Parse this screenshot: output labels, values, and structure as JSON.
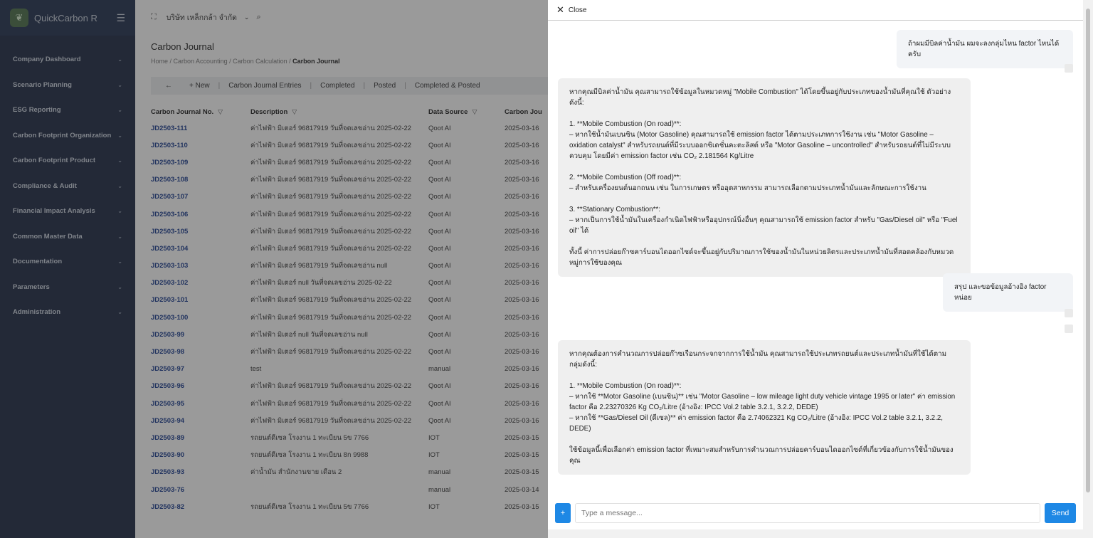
{
  "sidebar": {
    "app_name": "QuickCarbon R",
    "items": [
      {
        "label": "Company Dashboard"
      },
      {
        "label": "Scenario Planning"
      },
      {
        "label": "ESG Reporting"
      },
      {
        "label": "Carbon Footprint Organization"
      },
      {
        "label": "Carbon Footprint Product"
      },
      {
        "label": "Compliance & Audit"
      },
      {
        "label": "Financial Impact Analysis"
      },
      {
        "label": "Common Master Data"
      },
      {
        "label": "Documentation"
      },
      {
        "label": "Parameters"
      },
      {
        "label": "Administration"
      }
    ]
  },
  "topbar": {
    "company": "บริษัท เหล็กกล้า จำกัด"
  },
  "page": {
    "title": "Carbon Journal",
    "breadcrumb": [
      "Home",
      "Carbon Accounting",
      "Carbon Calculation",
      "Carbon Journal"
    ]
  },
  "toolbar": {
    "new_label": "New",
    "tabs": [
      "Carbon Journal Entries",
      "Completed",
      "Posted",
      "Completed & Posted"
    ]
  },
  "grid": {
    "columns": [
      "Carbon Journal No.",
      "Description",
      "Data Source",
      "Carbon Jou"
    ],
    "rows": [
      [
        "JD2503-111",
        "ค่าไฟฟ้า มิเตอร์ 96817919 วันที่จดเลขอ่าน 2025-02-22",
        "Qoot AI",
        "2025-03-16"
      ],
      [
        "JD2503-110",
        "ค่าไฟฟ้า มิเตอร์ 96817919 วันที่จดเลขอ่าน 2025-02-22",
        "Qoot AI",
        "2025-03-16"
      ],
      [
        "JD2503-109",
        "ค่าไฟฟ้า มิเตอร์ 96817919 วันที่จดเลขอ่าน 2025-02-22",
        "Qoot AI",
        "2025-03-16"
      ],
      [
        "JD2503-108",
        "ค่าไฟฟ้า มิเตอร์ 96817919 วันที่จดเลขอ่าน 2025-02-22",
        "Qoot AI",
        "2025-03-16"
      ],
      [
        "JD2503-107",
        "ค่าไฟฟ้า มิเตอร์ 96817919 วันที่จดเลขอ่าน 2025-02-22",
        "Qoot AI",
        "2025-03-16"
      ],
      [
        "JD2503-106",
        "ค่าไฟฟ้า มิเตอร์ 96817919 วันที่จดเลขอ่าน 2025-02-22",
        "Qoot AI",
        "2025-03-16"
      ],
      [
        "JD2503-105",
        "ค่าไฟฟ้า มิเตอร์ 96817919 วันที่จดเลขอ่าน 2025-02-22",
        "Qoot AI",
        "2025-03-16"
      ],
      [
        "JD2503-104",
        "ค่าไฟฟ้า มิเตอร์ 96817919 วันที่จดเลขอ่าน 2025-02-22",
        "Qoot AI",
        "2025-03-16"
      ],
      [
        "JD2503-103",
        "ค่าไฟฟ้า มิเตอร์ 96817919 วันที่จดเลขอ่าน null",
        "Qoot AI",
        "2025-03-16"
      ],
      [
        "JD2503-102",
        "ค่าไฟฟ้า มิเตอร์ null วันที่จดเลขอ่าน 2025-02-22",
        "Qoot AI",
        "2025-03-16"
      ],
      [
        "JD2503-101",
        "ค่าไฟฟ้า มิเตอร์ 96817919 วันที่จดเลขอ่าน 2025-02-22",
        "Qoot AI",
        "2025-03-16"
      ],
      [
        "JD2503-100",
        "ค่าไฟฟ้า มิเตอร์ 96817919 วันที่จดเลขอ่าน 2025-02-22",
        "Qoot AI",
        "2025-03-16"
      ],
      [
        "JD2503-99",
        "ค่าไฟฟ้า มิเตอร์ null วันที่จดเลขอ่าน null",
        "Qoot AI",
        "2025-03-16"
      ],
      [
        "JD2503-98",
        "ค่าไฟฟ้า มิเตอร์ 96817919 วันที่จดเลขอ่าน 2025-02-22",
        "Qoot AI",
        "2025-03-16"
      ],
      [
        "JD2503-97",
        "test",
        "manual",
        "2025-03-16"
      ],
      [
        "JD2503-96",
        "ค่าไฟฟ้า มิเตอร์ 96817919 วันที่จดเลขอ่าน 2025-02-22",
        "Qoot AI",
        "2025-03-16"
      ],
      [
        "JD2503-95",
        "ค่าไฟฟ้า มิเตอร์ 96817919 วันที่จดเลขอ่าน 2025-02-22",
        "Qoot AI",
        "2025-03-16"
      ],
      [
        "JD2503-94",
        "ค่าไฟฟ้า มิเตอร์ 96817919 วันที่จดเลขอ่าน 2025-02-22",
        "Qoot AI",
        "2025-03-16"
      ],
      [
        "JD2503-89",
        "รถยนต์ดีเซล โรงงาน 1 ทะเบียน 5ข 7766",
        "IOT",
        "2025-03-15"
      ],
      [
        "JD2503-90",
        "รถยนต์ดีเซล โรงงาน 1 ทะเบียน 8ก 9988",
        "IOT",
        "2025-03-15"
      ],
      [
        "JD2503-93",
        "ค่าน้ำมัน สำนักงานขาย เดือน 2",
        "manual",
        "2025-03-15"
      ],
      [
        "JD2503-76",
        "",
        "manual",
        "2025-03-14"
      ],
      [
        "JD2503-82",
        "รถยนต์ดีเซล โรงงาน 1 ทะเบียน 5ข 7766",
        "IOT",
        "2025-03-15"
      ]
    ]
  },
  "chat": {
    "close_label": "Close",
    "messages": [
      {
        "role": "user",
        "text": "ถ้าผมมีบิลค่าน้ำมัน ผมจะลงกลุ่มไหน factor ไหนได้ครับ"
      },
      {
        "role": "assistant",
        "text": "หากคุณมีบิลค่าน้ำมัน คุณสามารถใช้ข้อมูลในหมวดหมู่ \"Mobile Combustion\" ได้โดยขึ้นอยู่กับประเภทของน้ำมันที่คุณใช้ ตัวอย่างดังนี้:\n\n1. **Mobile Combustion (On road)**:\n– หากใช้น้ำมันเบนซิน (Motor Gasoline) คุณสามารถใช้ emission factor ได้ตามประเภทการใช้งาน เช่น \"Motor Gasoline – oxidation catalyst\" สำหรับรถยนต์ที่มีระบบออกซิเดชั่นคะตะลิสต์ หรือ \"Motor Gasoline – uncontrolled\" สำหรับรถยนต์ที่ไม่มีระบบควบคุม โดยมีค่า emission factor เช่น CO₂ 2.181564 Kg/Litre\n\n2. **Mobile Combustion (Off road)**:\n– สำหรับเครื่องยนต์นอกถนน เช่น ในการเกษตร หรืออุตสาหกรรม สามารถเลือกตามประเภทน้ำมันและลักษณะการใช้งาน\n\n3. **Stationary Combustion**:\n– หากเป็นการใช้น้ำมันในเครื่องกำเนิดไฟฟ้าหรืออุปกรณ์นิ่งอื่นๆ คุณสามารถใช้ emission factor สำหรับ \"Gas/Diesel oil\" หรือ \"Fuel oil\" ได้\n\nทั้งนี้ ค่าการปล่อยก๊าซคาร์บอนไดออกไซด์จะขึ้นอยู่กับปริมาณการใช้ของน้ำมันในหน่วยลิตรและประเภทน้ำมันที่สอดคล้องกับหมวดหมู่การใช้ของคุณ"
      },
      {
        "role": "user",
        "text": "สรุป และขอข้อมูลอ้างอิง factor หน่อย"
      },
      {
        "role": "assistant",
        "text": "หากคุณต้องการคำนวณการปล่อยก๊าซเรือนกระจกจากการใช้น้ำมัน คุณสามารถใช้ประเภทรถยนต์และประเภทน้ำมันที่ใช้ได้ตามกลุ่มดังนี้:\n\n1. **Mobile Combustion (On road)**:\n– หากใช้ **Motor Gasoline (เบนซิน)** เช่น \"Motor Gasoline – low mileage light duty vehicle vintage 1995 or later\" ค่า emission factor คือ 2.23270326 Kg CO₂/Litre (อ้างอิง: IPCC Vol.2 table 3.2.1, 3.2.2, DEDE)\n– หากใช้ **Gas/Diesel Oil (ดีเซล)** ค่า emission factor คือ 2.74062321 Kg CO₂/Litre (อ้างอิง: IPCC Vol.2 table 3.2.1, 3.2.2, DEDE)\n\nใช้ข้อมูลนี้เพื่อเลือกค่า emission factor ที่เหมาะสมสำหรับการคำนวณการปล่อยคาร์บอนไดออกไซด์ที่เกี่ยวข้องกับการใช้น้ำมันของคุณ"
      }
    ],
    "input_placeholder": "Type a message...",
    "plus_label": "+",
    "send_label": "Send"
  },
  "colors": {
    "sidebar_bg": "#1f2a44",
    "accent": "#1e88e5",
    "link": "#1d3d8c"
  }
}
